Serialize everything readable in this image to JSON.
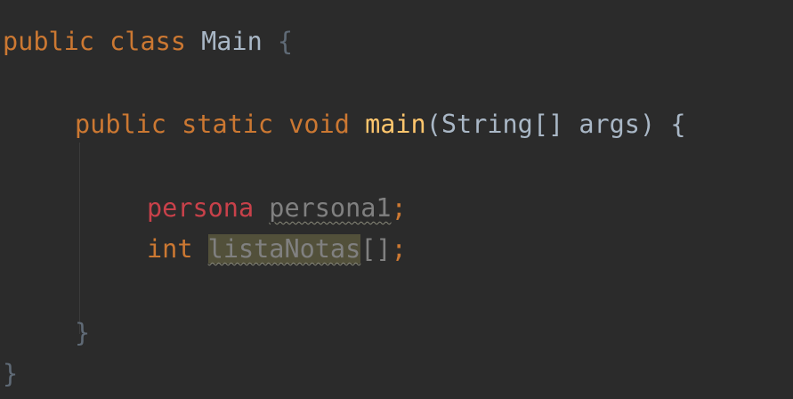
{
  "editor": {
    "line1": {
      "kw_public": "public",
      "kw_class": "class",
      "class_name": "Main",
      "open_brace": "{"
    },
    "line2": {
      "kw_public": "public",
      "kw_static": "static",
      "kw_void": "void",
      "method_name": "main",
      "open_paren": "(",
      "param_type": "String[]",
      "param_name": "args",
      "close_paren": ")",
      "open_brace": "{"
    },
    "line3": {
      "type": "persona",
      "var_name": "persona1",
      "semicolon": ";"
    },
    "line4": {
      "type": "int",
      "var_name": "listaNotas",
      "brackets": "[]",
      "semicolon": ";"
    },
    "line5": {
      "close_brace": "}"
    },
    "line6": {
      "close_brace": "}"
    }
  },
  "colors": {
    "background": "#2b2b2b",
    "keyword": "#cc7832",
    "method": "#ffc66d",
    "default_text": "#a9b7c6",
    "unresolved_type": "#c8414a",
    "unused_variable": "#808080",
    "identifier_highlight": "#52503a"
  }
}
